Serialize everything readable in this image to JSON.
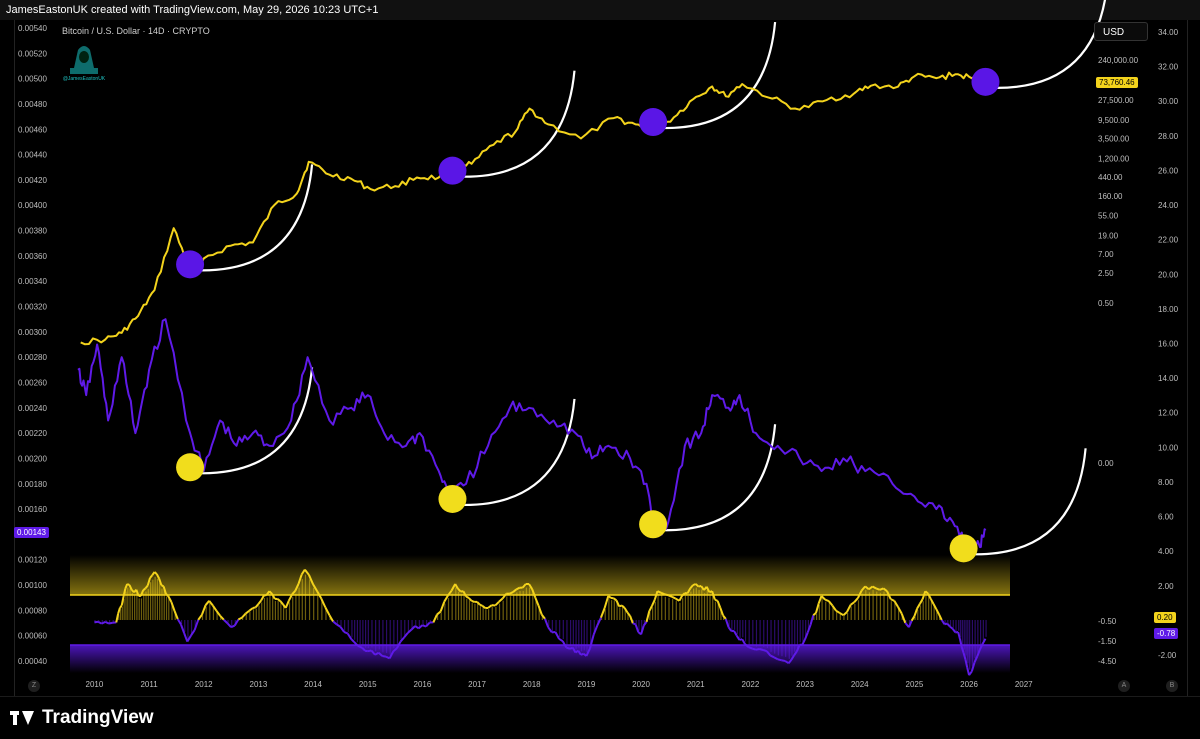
{
  "header": {
    "credit": "JamesEastonUK created with TradingView.com, May 29, 2026 10:23 UTC+1"
  },
  "legend": {
    "symbol_line": "Bitcoin / U.S. Dollar · 14D · CRYPTO",
    "logo_caption": "@JamesEastonUK"
  },
  "controls": {
    "currency_button": "USD",
    "corner_left": "Z",
    "corner_a": "A",
    "corner_b": "B"
  },
  "footer": {
    "brand": "TradingView"
  },
  "colors": {
    "background": "#000000",
    "price_line": "#f3d31c",
    "oscillator_line": "#5f1ae8",
    "circle_purple": "#5a16e6",
    "circle_yellow": "#f1dd1c",
    "projection_arc": "#ffffff",
    "axis_text": "#bfbfbf"
  },
  "chart_data": {
    "type": "line",
    "title": "Bitcoin / U.S. Dollar · 14D · CRYPTO",
    "xlabel": "",
    "xlim": [
      2009.7,
      2027.7
    ],
    "x_ticks": [
      "2010",
      "2011",
      "2012",
      "2013",
      "2014",
      "2015",
      "2016",
      "2017",
      "2018",
      "2019",
      "2020",
      "2021",
      "2022",
      "2023",
      "2024",
      "2025",
      "2026",
      "2027"
    ],
    "grid": false,
    "legend": "none",
    "left_axis": {
      "ylim": [
        0.0004,
        0.0054
      ],
      "ticks": [
        "0.00540",
        "0.00520",
        "0.00500",
        "0.00480",
        "0.00460",
        "0.00440",
        "0.00420",
        "0.00400",
        "0.00380",
        "0.00360",
        "0.00340",
        "0.00320",
        "0.00300",
        "0.00280",
        "0.00260",
        "0.00240",
        "0.00220",
        "0.00200",
        "0.00180",
        "0.00160",
        "0.00140",
        "0.00120",
        "0.00100",
        "0.00080",
        "0.00060",
        "0.00040"
      ],
      "last_value_label": "0.00143"
    },
    "price_axis": {
      "scale": "log",
      "ticks": [
        "240,000.00",
        "27,500.00",
        "9,500.00",
        "3,500.00",
        "1,200.00",
        "440.00",
        "160.00",
        "55.00",
        "19.00",
        "7.00",
        "2.50",
        "0.50"
      ],
      "last_value_label": "73,760.46"
    },
    "right_axis": {
      "ylim": [
        -2.0,
        34.0
      ],
      "ticks": [
        "34.00",
        "32.00",
        "30.00",
        "28.00",
        "26.00",
        "24.00",
        "22.00",
        "20.00",
        "18.00",
        "16.00",
        "14.00",
        "12.00",
        "10.00",
        "8.00",
        "6.00",
        "4.00",
        "2.00",
        "-2.00"
      ]
    },
    "oscillator_axis": {
      "ticks": [
        "0.00",
        "-0.50",
        "-1.50",
        "-4.50"
      ],
      "labels": {
        "upper": "0.20",
        "lower": "-0.78"
      }
    },
    "series": [
      {
        "role": "price",
        "scale": "log",
        "x": [
          2009.75,
          2010.2,
          2010.5,
          2010.8,
          2011.1,
          2011.45,
          2011.75,
          2012.0,
          2012.5,
          2012.9,
          2013.3,
          2013.7,
          2013.92,
          2014.3,
          2014.7,
          2015.05,
          2015.5,
          2015.9,
          2016.3,
          2016.6,
          2016.9,
          2017.3,
          2017.7,
          2017.96,
          2018.3,
          2018.9,
          2019.5,
          2019.9,
          2020.22,
          2020.6,
          2020.95,
          2021.3,
          2021.55,
          2021.85,
          2022.4,
          2022.9,
          2023.4,
          2023.9,
          2024.2,
          2024.7,
          2025.0,
          2025.4,
          2025.75,
          2026.05,
          2026.3
        ],
        "y": [
          0.06,
          0.07,
          0.1,
          0.25,
          1.0,
          28,
          3.0,
          5.5,
          11,
          13,
          100,
          180,
          1000,
          500,
          400,
          230,
          270,
          430,
          430,
          620,
          900,
          2500,
          5000,
          17500,
          7500,
          3500,
          10500,
          7500,
          5000,
          11000,
          29000,
          58000,
          34000,
          66000,
          30000,
          16500,
          28000,
          40000,
          60000,
          57000,
          100000,
          90000,
          112000,
          90000,
          74000
        ]
      },
      {
        "role": "oscillator",
        "scale": "left",
        "x": [
          2009.7,
          2009.85,
          2010.05,
          2010.25,
          2010.5,
          2010.75,
          2011.0,
          2011.3,
          2011.75,
          2012.0,
          2012.3,
          2012.6,
          2012.9,
          2013.2,
          2013.6,
          2013.9,
          2014.3,
          2014.7,
          2015.0,
          2015.3,
          2015.7,
          2015.95,
          2016.3,
          2016.5,
          2016.8,
          2017.2,
          2017.6,
          2017.95,
          2018.4,
          2018.8,
          2019.1,
          2019.4,
          2019.8,
          2020.1,
          2020.25,
          2020.5,
          2020.8,
          2021.1,
          2021.3,
          2021.6,
          2021.8,
          2022.1,
          2022.5,
          2022.9,
          2023.3,
          2023.7,
          2024.1,
          2024.6,
          2025.0,
          2025.4,
          2025.7,
          2025.95,
          2026.2,
          2026.3
        ],
        "y": [
          0.0027,
          0.0025,
          0.0029,
          0.0023,
          0.0028,
          0.0022,
          0.0027,
          0.0031,
          0.0022,
          0.0019,
          0.0023,
          0.0021,
          0.0022,
          0.0021,
          0.0023,
          0.0028,
          0.0023,
          0.0024,
          0.0025,
          0.0022,
          0.0021,
          0.0022,
          0.0019,
          0.0017,
          0.0018,
          0.0021,
          0.0024,
          0.0024,
          0.0023,
          0.0022,
          0.002,
          0.0021,
          0.002,
          0.0018,
          0.0014,
          0.0015,
          0.0021,
          0.0022,
          0.0025,
          0.0024,
          0.0025,
          0.0022,
          0.0021,
          0.002,
          0.0019,
          0.002,
          0.0019,
          0.0018,
          0.0017,
          0.0016,
          0.0015,
          0.0013,
          0.0013,
          0.00143
        ]
      },
      {
        "role": "momentum",
        "scale": "right",
        "x": [
          2010.0,
          2010.4,
          2010.6,
          2010.85,
          2011.1,
          2011.35,
          2011.7,
          2012.1,
          2012.5,
          2012.9,
          2013.2,
          2013.5,
          2013.85,
          2014.3,
          2014.7,
          2015.0,
          2015.4,
          2015.8,
          2016.2,
          2016.6,
          2016.9,
          2017.2,
          2017.6,
          2017.95,
          2018.3,
          2018.7,
          2019.0,
          2019.4,
          2019.7,
          2020.0,
          2020.3,
          2020.7,
          2021.0,
          2021.3,
          2021.6,
          2021.9,
          2022.3,
          2022.7,
          2023.0,
          2023.3,
          2023.7,
          2024.1,
          2024.5,
          2024.9,
          2025.2,
          2025.5,
          2025.8,
          2026.0,
          2026.3
        ],
        "y": [
          -0.1,
          -0.1,
          1.5,
          1.0,
          2.0,
          1.0,
          -0.9,
          0.8,
          -0.3,
          0.5,
          1.2,
          0.5,
          2.1,
          0.2,
          -0.8,
          -1.3,
          -1.6,
          -0.4,
          -0.1,
          1.5,
          0.8,
          0.5,
          1.1,
          1.5,
          -0.3,
          -1.2,
          -1.5,
          1.0,
          0.5,
          -0.6,
          1.2,
          0.8,
          1.5,
          1.2,
          -0.3,
          -1.0,
          -1.3,
          -1.8,
          -0.8,
          1.0,
          0.2,
          1.4,
          1.2,
          -0.3,
          1.2,
          0.0,
          -0.5,
          -2.3,
          -0.78
        ]
      }
    ],
    "annotations": [
      {
        "kind": "purple_circle",
        "x": 2011.75,
        "scale": "price",
        "value": 4.0
      },
      {
        "kind": "purple_circle",
        "x": 2016.55,
        "scale": "price",
        "value": 620
      },
      {
        "kind": "purple_circle",
        "x": 2020.22,
        "scale": "price",
        "value": 8500
      },
      {
        "kind": "purple_circle",
        "x": 2026.3,
        "scale": "price",
        "value": 74000
      },
      {
        "kind": "yellow_circle",
        "x": 2011.75,
        "scale": "left",
        "value": 0.00193
      },
      {
        "kind": "yellow_circle",
        "x": 2016.55,
        "scale": "left",
        "value": 0.00168
      },
      {
        "kind": "yellow_circle",
        "x": 2020.22,
        "scale": "left",
        "value": 0.00148
      },
      {
        "kind": "yellow_circle",
        "x": 2025.9,
        "scale": "left",
        "value": 0.00129
      }
    ]
  }
}
